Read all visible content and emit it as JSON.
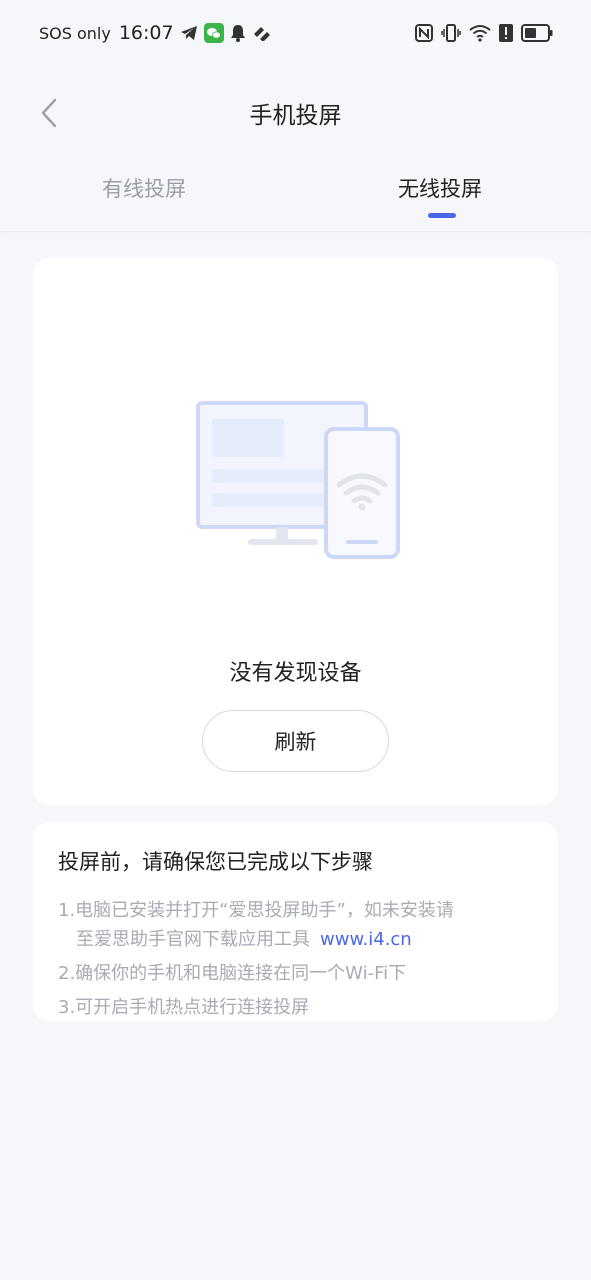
{
  "status_bar": {
    "carrier": "SOS only",
    "time": "16:07",
    "icons": [
      "telegram-icon",
      "wechat-icon",
      "bell-icon",
      "app-icon",
      "nfc-icon",
      "vibrate-icon",
      "wifi-icon",
      "alert-icon",
      "battery-icon"
    ]
  },
  "header": {
    "title": "手机投屏",
    "tabs": [
      {
        "label": "有线投屏",
        "active": false
      },
      {
        "label": "无线投屏",
        "active": true
      }
    ]
  },
  "device_card": {
    "empty_text": "没有发现设备",
    "refresh_label": "刷新"
  },
  "steps": {
    "title": "投屏前，请确保您已完成以下步骤",
    "items": [
      {
        "line1": "1.电脑已安装并打开“爱思投屏助手”，如未安装请",
        "line2": "至爱思助手官网下载应用工具",
        "link": "www.i4.cn"
      },
      {
        "text": "2.确保你的手机和电脑连接在同一个Wi-Fi下"
      },
      {
        "text": "3.可开启手机热点进行连接投屏"
      }
    ]
  },
  "colors": {
    "accent": "#4a67e8",
    "background": "#f5f7fb",
    "muted_text": "#a7abb4"
  }
}
